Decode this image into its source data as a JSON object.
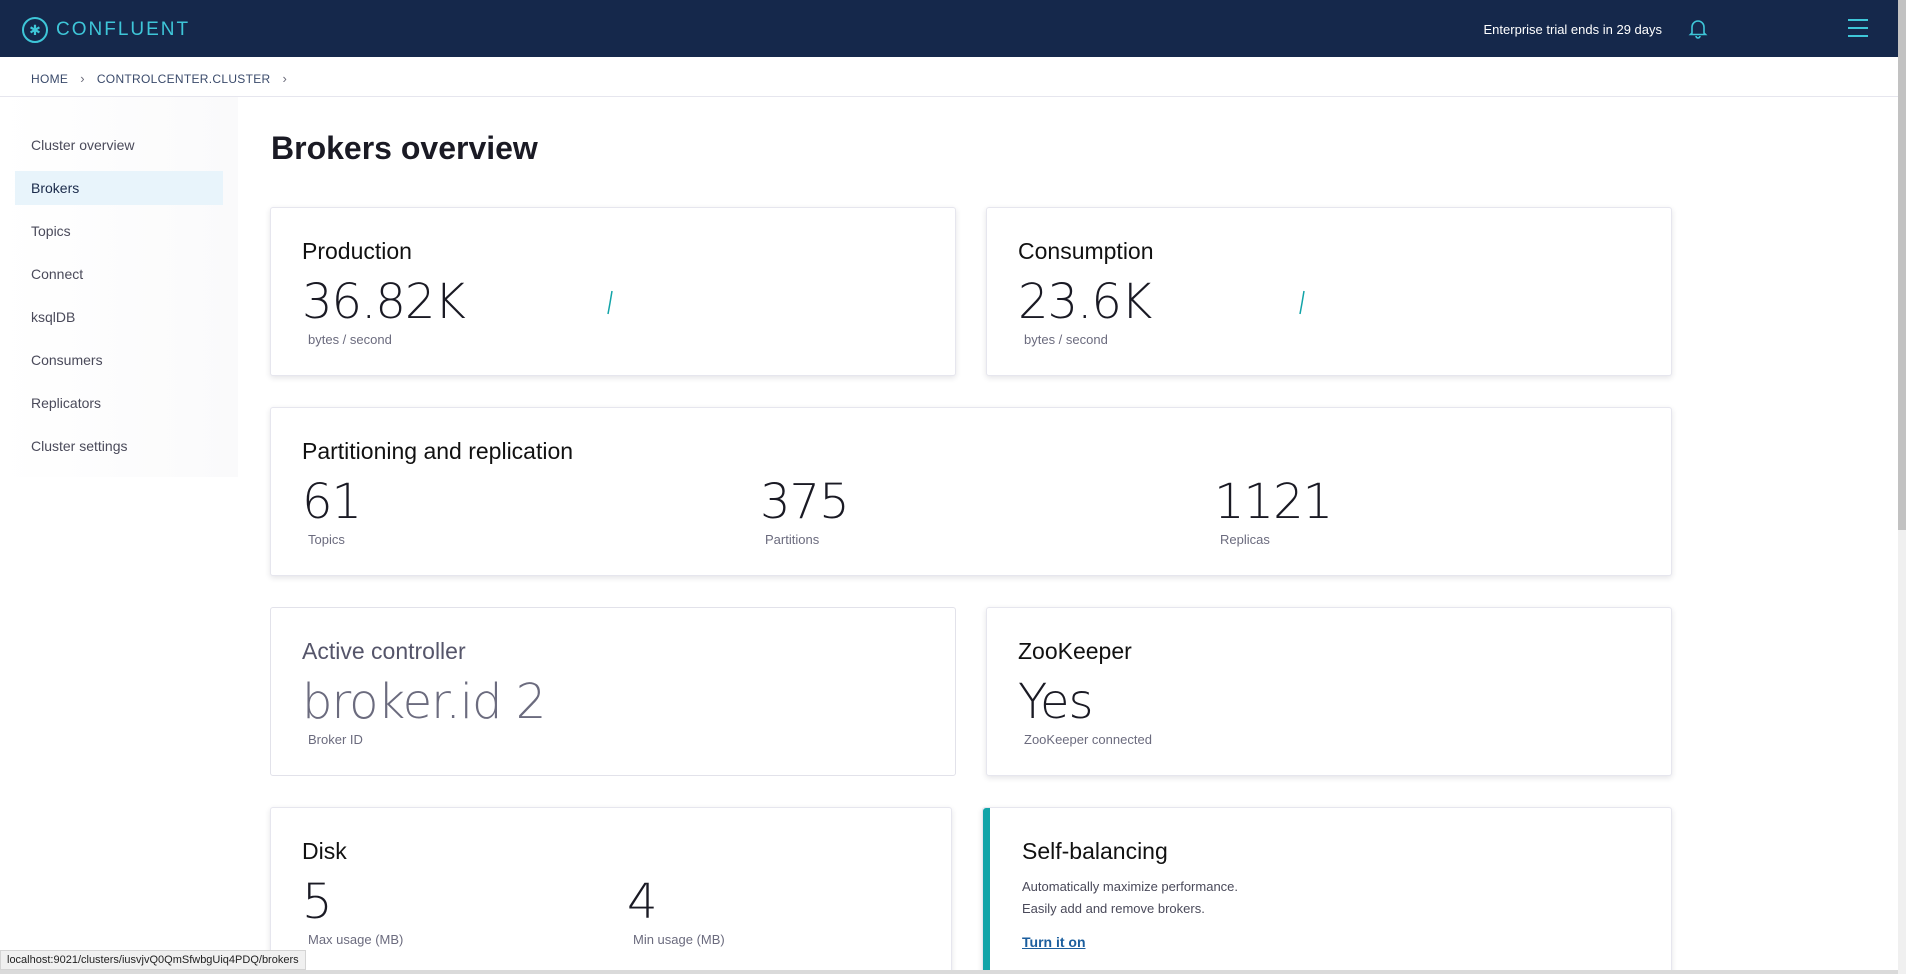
{
  "header": {
    "brand": "CONFLUENT",
    "trial_text": "Enterprise trial ends in 29 days",
    "icons": {
      "logo": "confluent-logo-icon",
      "bell": "bell-icon",
      "menu": "hamburger-menu-icon"
    },
    "bg_color": "#15284b",
    "accent_color": "#3ec6d8"
  },
  "breadcrumb": {
    "home": "HOME",
    "cluster": "CONTROLCENTER.CLUSTER"
  },
  "sidebar": {
    "items": [
      {
        "label": "Cluster overview",
        "active": false
      },
      {
        "label": "Brokers",
        "active": true
      },
      {
        "label": "Topics",
        "active": false
      },
      {
        "label": "Connect",
        "active": false
      },
      {
        "label": "ksqlDB",
        "active": false
      },
      {
        "label": "Consumers",
        "active": false
      },
      {
        "label": "Replicators",
        "active": false
      },
      {
        "label": "Cluster settings",
        "active": false
      }
    ]
  },
  "main": {
    "title": "Brokers overview",
    "production": {
      "title": "Production",
      "value": "36.82K",
      "unit": "bytes / second"
    },
    "consumption": {
      "title": "Consumption",
      "value": "23.6K",
      "unit": "bytes / second"
    },
    "partitioning": {
      "title": "Partitioning and replication",
      "topics": {
        "value": "61",
        "label": "Topics"
      },
      "partitions": {
        "value": "375",
        "label": "Partitions"
      },
      "replicas": {
        "value": "1121",
        "label": "Replicas"
      }
    },
    "controller": {
      "title": "Active controller",
      "value": "broker.id 2",
      "label": "Broker ID"
    },
    "zookeeper": {
      "title": "ZooKeeper",
      "value": "Yes",
      "label": "ZooKeeper connected"
    },
    "disk": {
      "title": "Disk",
      "max": {
        "value": "5",
        "label": "Max usage (MB)"
      },
      "min": {
        "value": "4",
        "label": "Min usage (MB)"
      }
    },
    "self_balancing": {
      "title": "Self-balancing",
      "line1": "Automatically maximize performance.",
      "line2": "Easily add and remove brokers.",
      "link": "Turn it on",
      "accent_color": "#12a4a8"
    }
  },
  "status_bar": {
    "url": "localhost:9021/clusters/iusvjvQ0QmSfwbgUiq4PDQ/brokers"
  }
}
